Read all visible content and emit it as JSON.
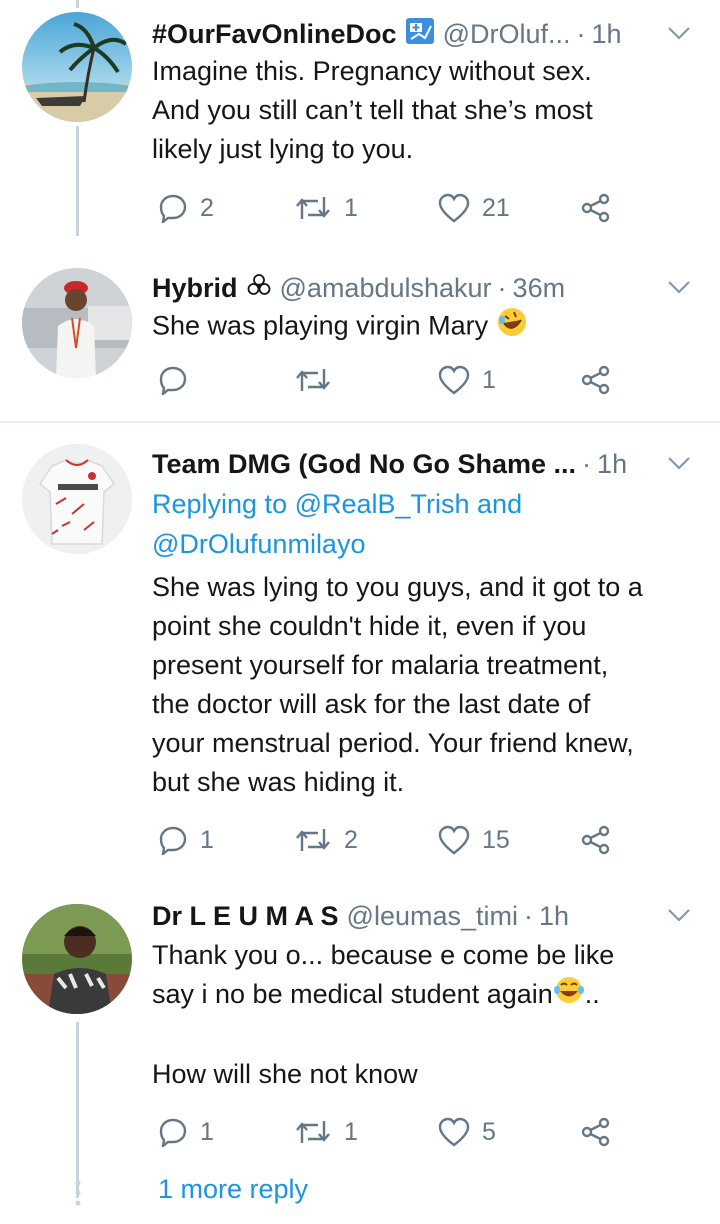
{
  "tweets": [
    {
      "name": "#OurFavOnlineDoc",
      "badge_icon": "medical-doc-badge",
      "handle": "@DrOluf...",
      "time": "1h",
      "lines": [
        "Imagine this. Pregnancy without sex.",
        "And you still can’t tell that she’s most",
        "likely just lying to you."
      ],
      "replies": "2",
      "retweets": "1",
      "likes": "21"
    },
    {
      "name": "Hybrid",
      "badge_icon": "biohazard-icon",
      "handle": "@amabdulshakur",
      "time": "36m",
      "lines": [
        "She was playing virgin Mary"
      ],
      "emoji_icon": "rofl-emoji",
      "replies": "",
      "retweets": "",
      "likes": "1"
    },
    {
      "name": "Team DMG (God No Go Shame ...",
      "handle": "",
      "time": "1h",
      "replying_to": [
        "Replying to @RealB_Trish and",
        "@DrOlufunmilayo"
      ],
      "lines": [
        "She was lying to you guys, and it got to a",
        "point she couldn't hide it, even if you",
        "present yourself for malaria treatment,",
        "the doctor will ask for the last date of",
        "your menstrual period. Your friend knew,",
        "but she was hiding it."
      ],
      "replies": "1",
      "retweets": "2",
      "likes": "15"
    },
    {
      "name": "Dr L E U M A S",
      "handle": "@leumas_timi",
      "time": "1h",
      "lines": [
        "Thank you o... because e come be like",
        "say i no be medical student again",
        "..",
        "",
        "How will she not know"
      ],
      "emoji_icon": "joy-emoji",
      "replies": "1",
      "retweets": "1",
      "likes": "5"
    }
  ],
  "more_replies": "1 more reply",
  "separator": "·",
  "colors": {
    "accent": "#1b95e0",
    "secondary_text": "#657786",
    "icon": "#657786",
    "divider": "#e6ecf0",
    "thread_line": "#c9d3db"
  }
}
